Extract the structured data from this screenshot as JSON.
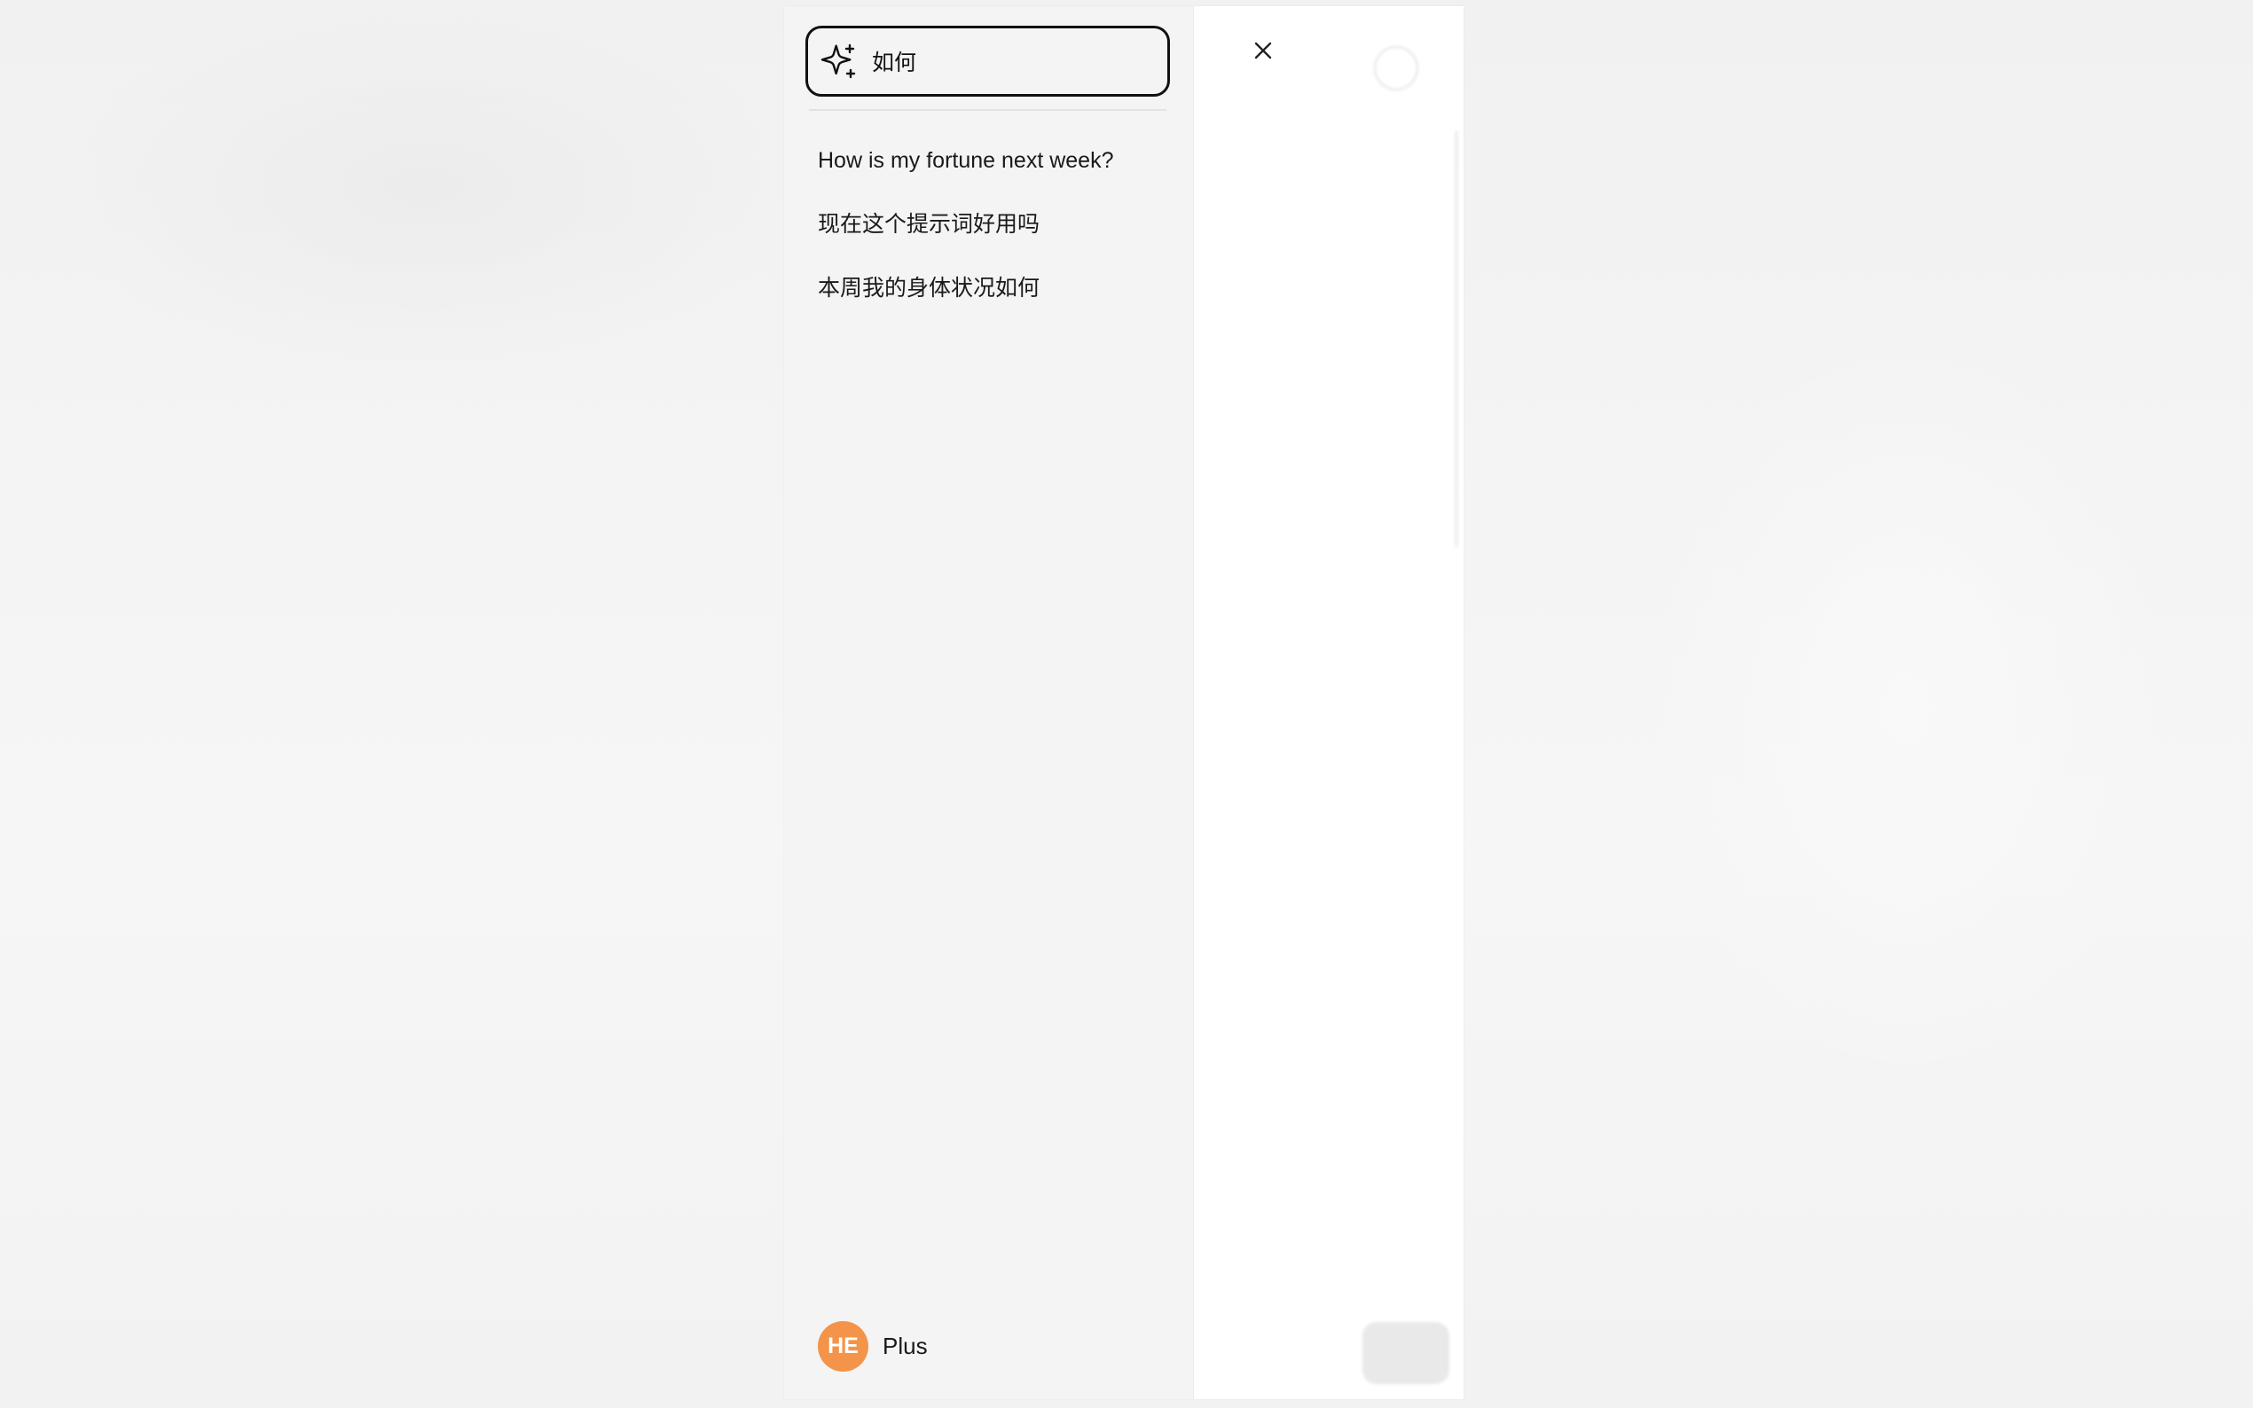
{
  "search": {
    "value": "如何",
    "icon": "sparkle-icon"
  },
  "history": {
    "items": [
      {
        "label": "How is my fortune next week?"
      },
      {
        "label": "现在这个提示词好用吗"
      },
      {
        "label": "本周我的身体状况如何"
      }
    ]
  },
  "user": {
    "initials": "HE",
    "plan": "Plus",
    "avatar_color": "#f4944a"
  },
  "colors": {
    "sidebar_bg": "#f4f4f4",
    "search_border": "#111111"
  }
}
